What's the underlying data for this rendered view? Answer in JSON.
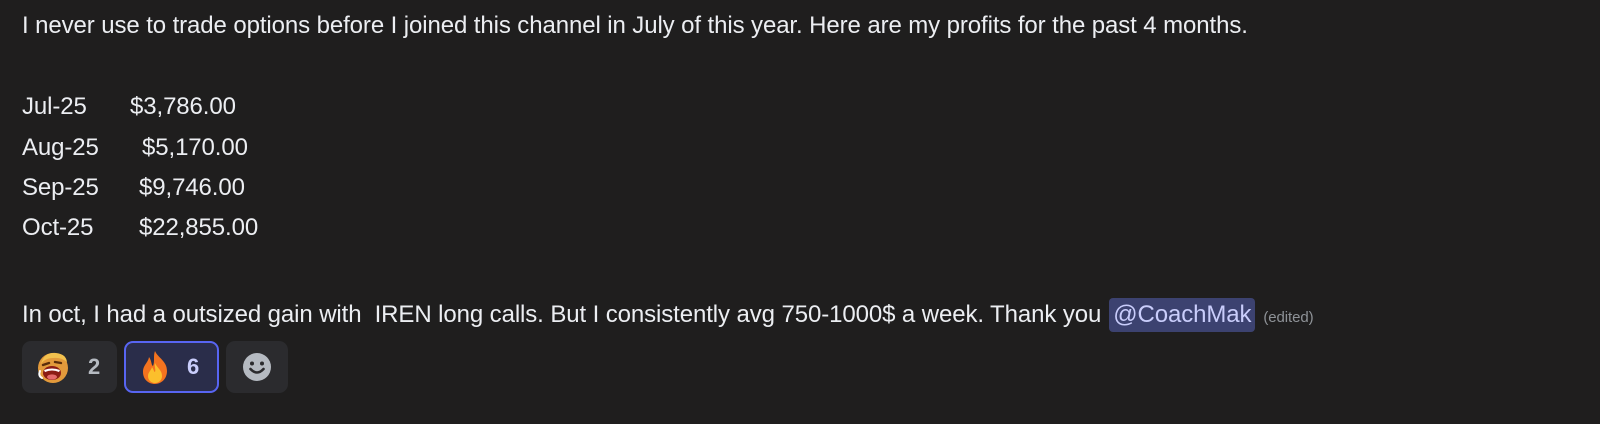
{
  "message": {
    "line1": "I never use to trade options before I joined this channel in July of this year. Here are my profits for the past 4 months.",
    "profits": [
      {
        "month": "Jul-25",
        "amount": "$3,786.00"
      },
      {
        "month": "Aug-25",
        "amount": "$5,170.00"
      },
      {
        "month": "Sep-25",
        "amount": "$9,746.00"
      },
      {
        "month": "Oct-25",
        "amount": "$22,855.00"
      }
    ],
    "closing_text": "In oct, I had a outsized gain with  IREN long calls. But I consistently avg 750-1000$ a week. Thank you",
    "mention": "@CoachMak",
    "edited_label": "(edited)"
  },
  "reactions": [
    {
      "emoji": "laughing-face-emoji",
      "count": "2",
      "selected": false
    },
    {
      "emoji": "fire-emoji",
      "count": "6",
      "selected": true
    }
  ],
  "add_reaction": {
    "icon": "smiley-add-reaction-icon"
  },
  "colors": {
    "background": "#1f1e1e",
    "text": "#eceef2",
    "mention_bg": "#3c4270",
    "mention_text": "#c9cdfb",
    "reaction_bg": "#2b2b2e",
    "reaction_selected_border": "#5865f2"
  }
}
